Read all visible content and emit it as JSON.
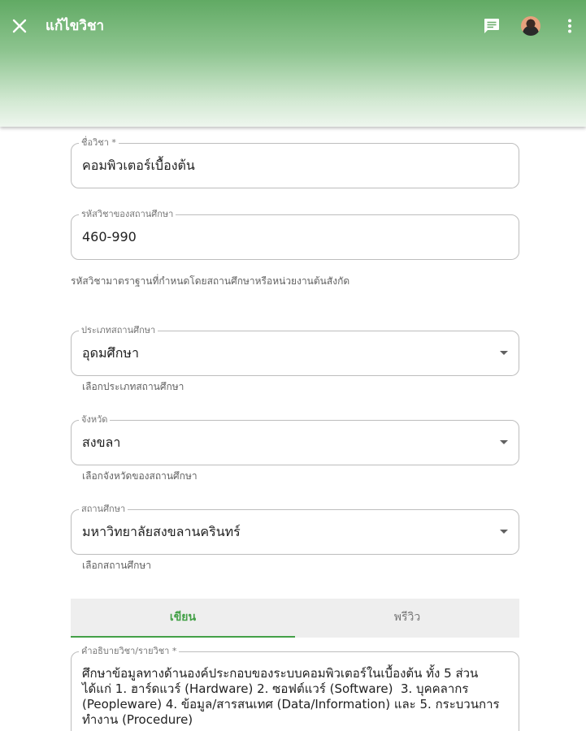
{
  "appbar": {
    "title": "แก้ไขวิชา",
    "icons": [
      "close-icon",
      "chat-icon",
      "user-avatar",
      "more-vert-icon"
    ]
  },
  "form": {
    "course_name": {
      "label": "ชื่อวิชา *",
      "value": "คอมพิวเตอร์เบื้องต้น"
    },
    "institution_code": {
      "label": "รหัสวิชาของสถานศึกษา",
      "value": "460-990"
    },
    "standard_code_hint": "รหัสวิชามาตราฐานที่กำหนดโดยสถานศึกษาหรือหน่วยงานต้นสังกัด",
    "institution_type": {
      "label": "ประเภทสถานศึกษา",
      "value": "อุดมศึกษา",
      "hint": "เลือกประเภทสถานศึกษา"
    },
    "province": {
      "label": "จังหวัด",
      "value": "สงขลา",
      "hint": "เลือกจังหวัดของสถานศึกษา"
    },
    "institution": {
      "label": "สถานศึกษา",
      "value": "มหาวิทยาลัยสงขลานครินทร์",
      "hint": "เลือกสถานศึกษา"
    },
    "tabs": {
      "write": "เขียน",
      "preview": "พรีวิว"
    },
    "description": {
      "label": "คำอธิบายวิชา/รายวิชา *",
      "value": "ศึกษาข้อมูลทางด้านองค์ประกอบของระบบคอมพิวเตอร์ในเบื้องต้น ทั้ง 5 ส่วน ได้แก่ 1. ฮาร์ดแวร์ (Hardware) 2. ซอฟต์แวร์ (Software)  3. บุคคลากร (Peopleware) 4. ข้อมูล/สารสนเทศ (Data/Information) และ 5. กระบวนการทำงาน (Procedure)"
    }
  },
  "colors": {
    "appbar_top": "#61aa64",
    "accent": "#43a047",
    "outline": "#bdbdbd"
  }
}
